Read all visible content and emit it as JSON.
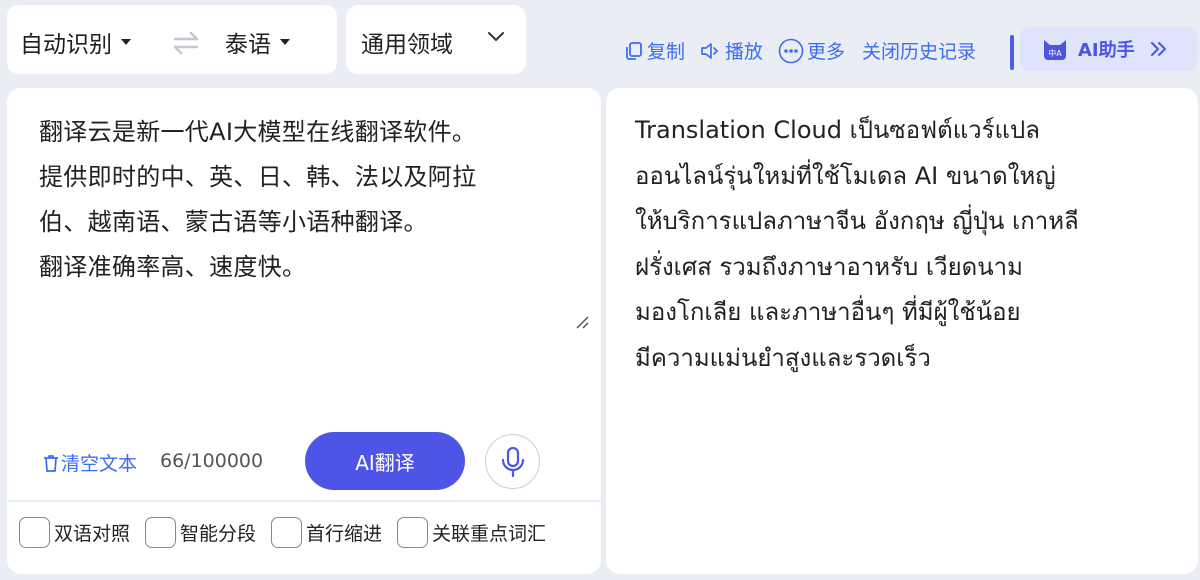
{
  "lang_bar": {
    "source_lang": "自动识别",
    "target_lang": "泰语",
    "swap_icon": "swap-arrows-icon"
  },
  "domain": {
    "label": "通用领域"
  },
  "toolbar": {
    "copy_label": "复制",
    "play_label": "播放",
    "more_label": "更多",
    "history_label": "关闭历史记录",
    "ai_assistant_label": "AI助手",
    "accent_color": "#3d6df2",
    "brand_color": "#4e55e6"
  },
  "source": {
    "text": "翻译云是新一代AI大模型在线翻译软件。\n提供即时的中、英、日、韩、法以及阿拉\n伯、越南语、蒙古语等小语种翻译。\n翻译准确率高、速度快。",
    "clear_label": "清空文本",
    "char_count": "66/100000",
    "translate_label": "AI翻译"
  },
  "options": [
    {
      "label": "双语对照",
      "checked": false
    },
    {
      "label": "智能分段",
      "checked": false
    },
    {
      "label": "首行缩进",
      "checked": false
    },
    {
      "label": "关联重点词汇",
      "checked": false
    }
  ],
  "result": {
    "text": "Translation Cloud เป็นซอฟต์แวร์แปล\nออนไลน์รุ่นใหม่ที่ใช้โมเดล AI ขนาดใหญ่\nให้บริการแปลภาษาจีน อังกฤษ ญี่ปุ่น เกาหลี\nฝรั่งเศส รวมถึงภาษาอาหรับ เวียดนาม\nมองโกเลีย และภาษาอื่นๆ ที่มีผู้ใช้น้อย\nมีความแม่นยำสูงและรวดเร็ว"
  }
}
